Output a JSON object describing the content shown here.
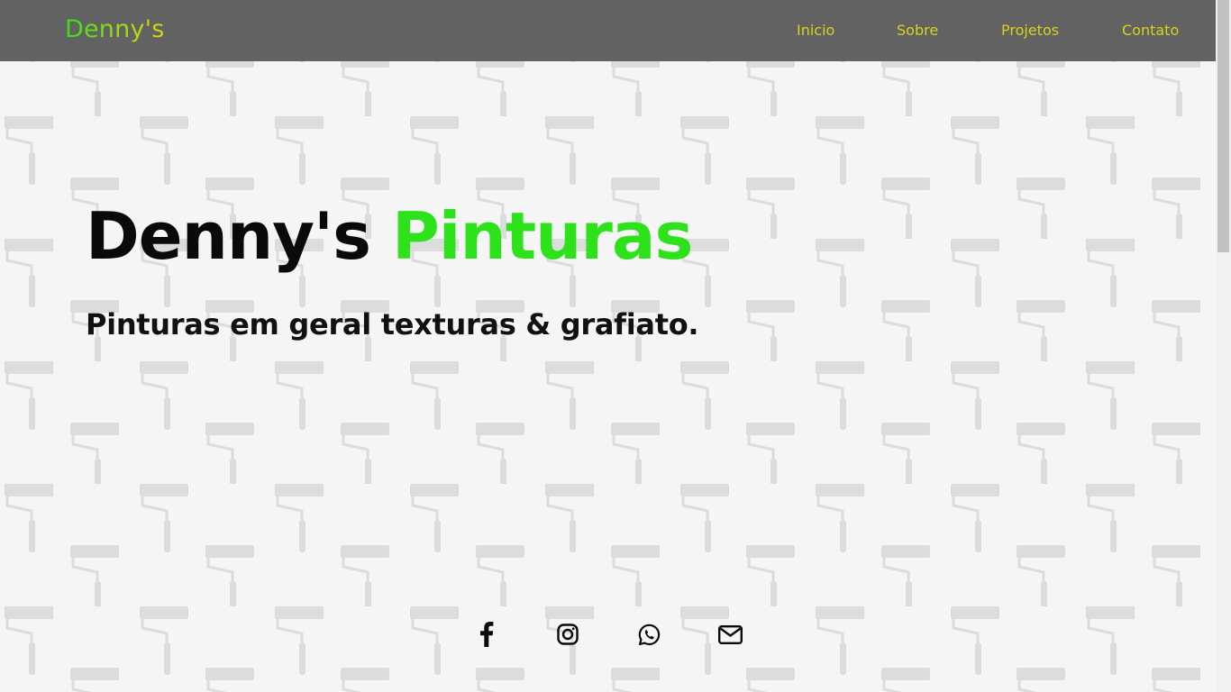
{
  "nav": {
    "brand": "Denny's",
    "links": [
      {
        "label": "Inicio"
      },
      {
        "label": "Sobre"
      },
      {
        "label": "Projetos"
      },
      {
        "label": "Contato"
      }
    ]
  },
  "hero": {
    "title_part1": "Denny's",
    "title_part2": "Pinturas",
    "subtitle": "Pinturas em geral texturas & grafiato."
  },
  "social": [
    {
      "icon": "facebook-icon"
    },
    {
      "icon": "instagram-icon"
    },
    {
      "icon": "whatsapp-icon"
    },
    {
      "icon": "email-icon"
    }
  ],
  "colors": {
    "navbar_bg": "#626262",
    "nav_link": "#d8d31c",
    "accent_green": "#2ee21b",
    "page_bg": "#f5f5f5",
    "pattern": "#dcdcdc"
  }
}
